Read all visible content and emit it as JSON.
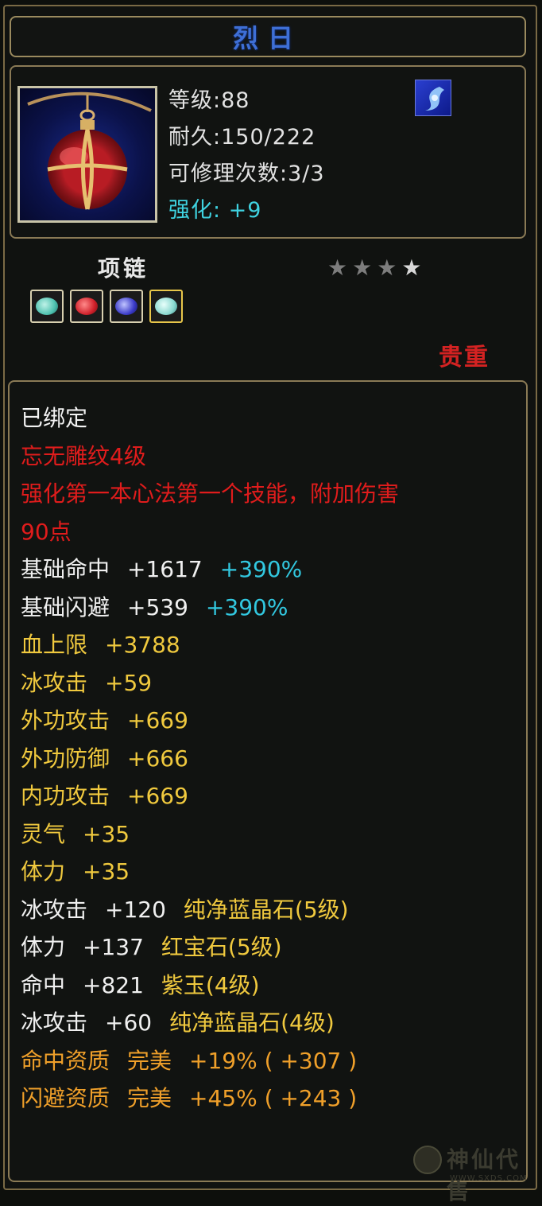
{
  "item": {
    "name": "烈日",
    "level": "等级:88",
    "durability": "耐久:150/222",
    "repairs": "可修理次数:3/3",
    "enhance": "强化:  +9",
    "type": "项链",
    "rarity": "贵重",
    "stars": [
      "★",
      "★",
      "★",
      "★"
    ],
    "gems": [
      {
        "name": "teal-gem",
        "color": "#4fc2b0"
      },
      {
        "name": "red-gem",
        "color": "#d0202a"
      },
      {
        "name": "purple-gem",
        "color": "#3a3ac8"
      },
      {
        "name": "teal-gem",
        "color": "#8ad8d0"
      }
    ]
  },
  "attributes": {
    "bound": "已绑定",
    "effect_name": "忘无雕纹4级",
    "effect_desc1": "强化第一本心法第一个技能，附加伤害",
    "effect_desc2": "90点",
    "rows": [
      {
        "label": "基础命中",
        "value": "+1617",
        "extra": "+390%",
        "kind": "base"
      },
      {
        "label": "基础闪避",
        "value": "+539",
        "extra": "+390%",
        "kind": "base"
      },
      {
        "label": "血上限",
        "value": "+3788",
        "kind": "attr"
      },
      {
        "label": "冰攻击",
        "value": "+59",
        "kind": "attr"
      },
      {
        "label": "外功攻击",
        "value": "+669",
        "kind": "attr"
      },
      {
        "label": "外功防御",
        "value": "+666",
        "kind": "attr"
      },
      {
        "label": "内功攻击",
        "value": "+669",
        "kind": "attr"
      },
      {
        "label": "灵气",
        "value": "+35",
        "kind": "attr"
      },
      {
        "label": "体力",
        "value": "+35",
        "kind": "attr"
      },
      {
        "label": "冰攻击",
        "value": "+120",
        "extra": "纯净蓝晶石(5级)",
        "kind": "gem"
      },
      {
        "label": "体力",
        "value": "+137",
        "extra": "红宝石(5级)",
        "kind": "gem"
      },
      {
        "label": "命中",
        "value": "+821",
        "extra": "紫玉(4级)",
        "kind": "gem"
      },
      {
        "label": "冰攻击",
        "value": "+60",
        "extra": "纯净蓝晶石(4级)",
        "kind": "gem"
      },
      {
        "label": "命中资质",
        "value": "完美",
        "extra": "+19%  ( +307 )",
        "kind": "qual"
      },
      {
        "label": "闪避资质",
        "value": "完美",
        "extra": "+45%  ( +243 )",
        "kind": "qual"
      }
    ]
  },
  "watermark": {
    "text": "神仙代售",
    "url": "WWW.SXDS.COM"
  }
}
